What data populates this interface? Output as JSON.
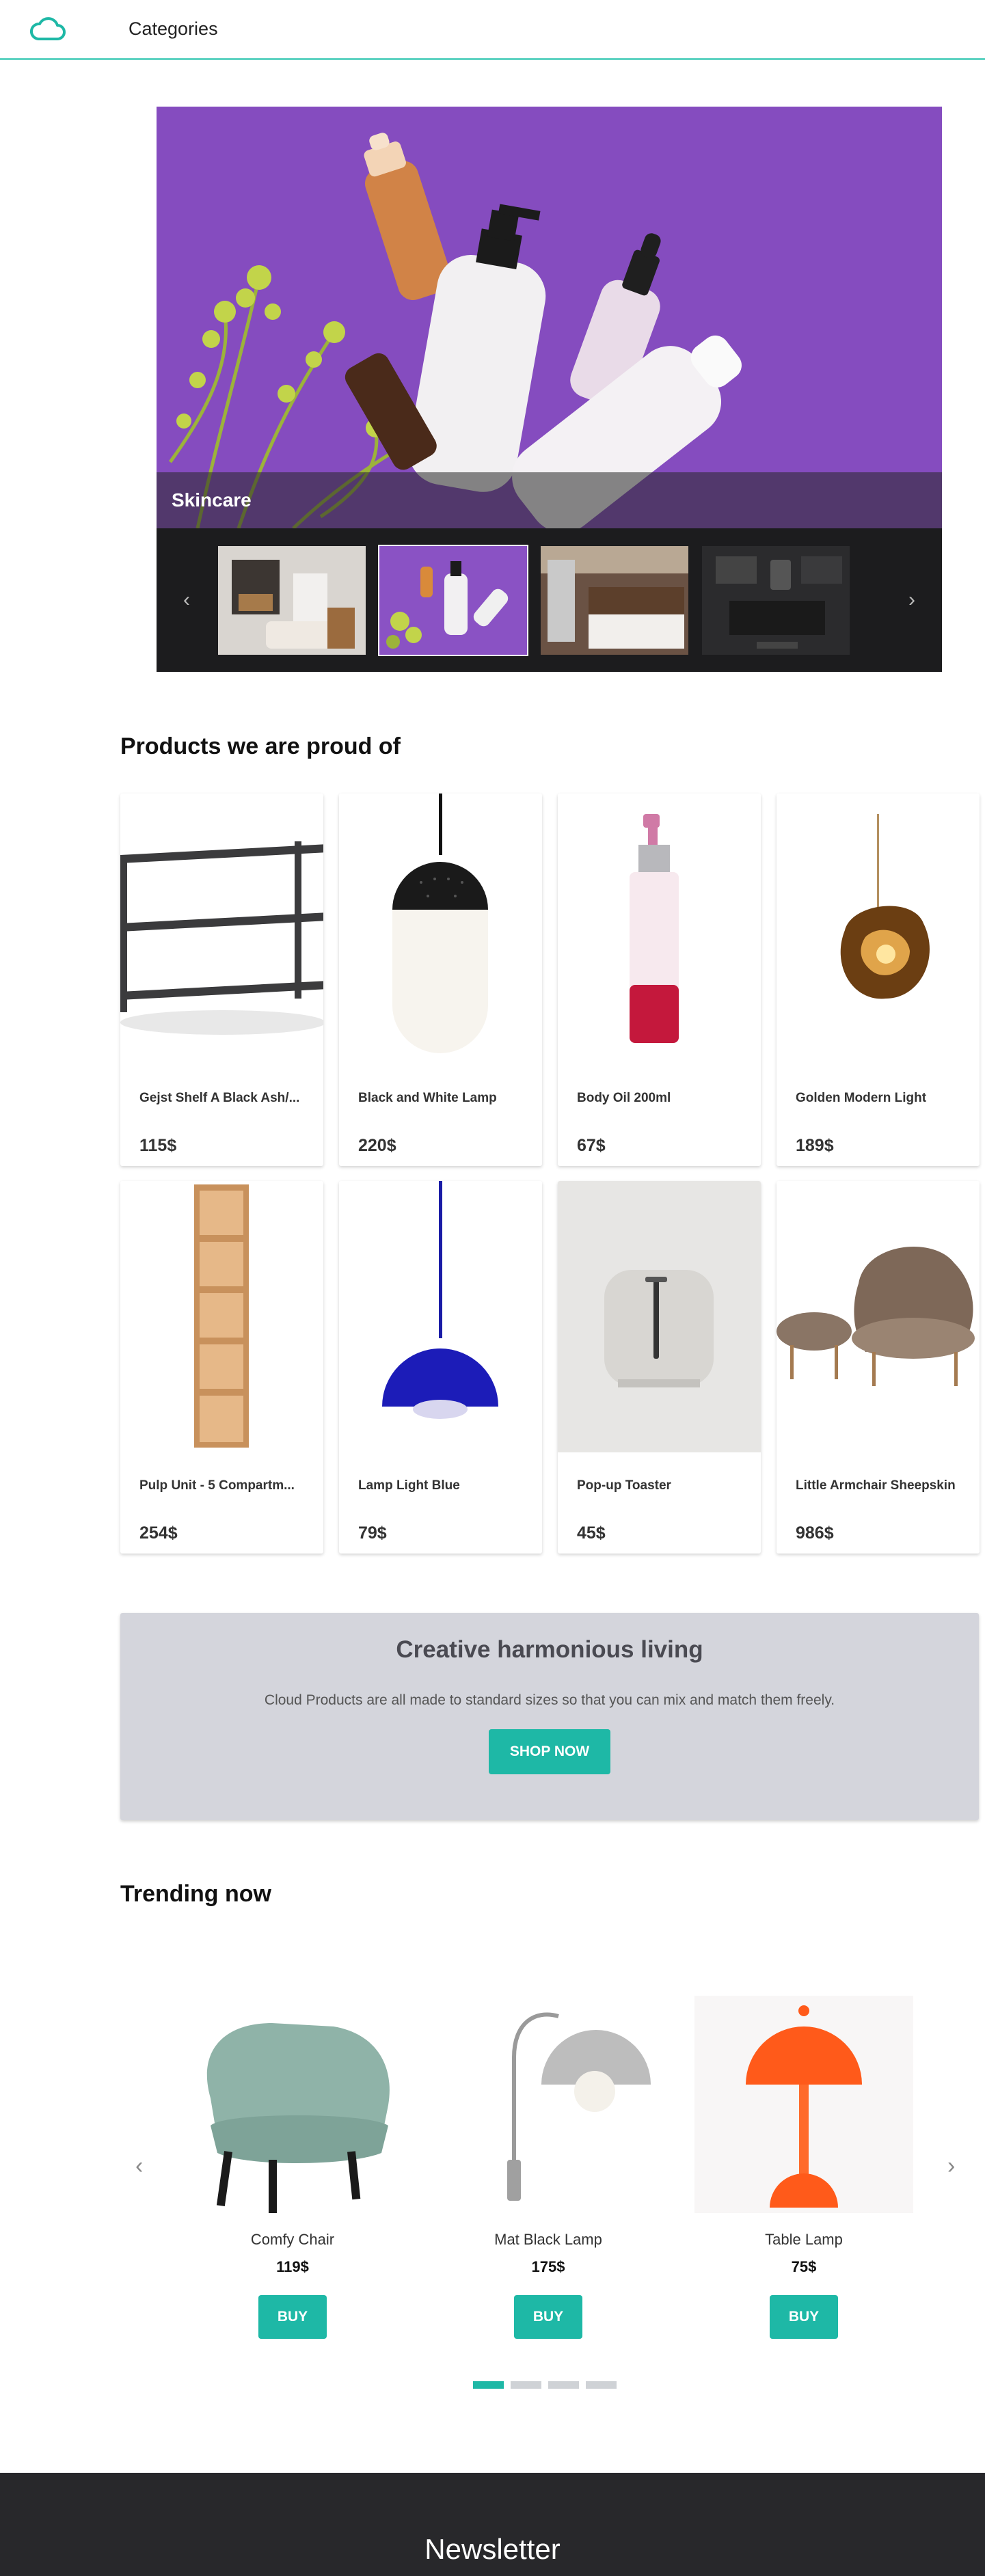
{
  "header": {
    "nav_label": "Categories"
  },
  "hero": {
    "caption": "Skincare",
    "thumbnails": [
      "living-room",
      "skincare",
      "kitchen",
      "desk-setup"
    ],
    "active_thumbnail": 1
  },
  "products_section": {
    "title": "Products we are proud of",
    "items": [
      {
        "name": "Gejst Shelf A Black Ash/...",
        "price": "115$"
      },
      {
        "name": "Black and White Lamp",
        "price": "220$"
      },
      {
        "name": "Body Oil 200ml",
        "price": "67$"
      },
      {
        "name": "Golden Modern Light",
        "price": "189$"
      },
      {
        "name": "Pulp Unit - 5 Compartm...",
        "price": "254$"
      },
      {
        "name": "Lamp Light Blue",
        "price": "79$"
      },
      {
        "name": "Pop-up Toaster",
        "price": "45$"
      },
      {
        "name": "Little Armchair Sheepskin",
        "price": "986$"
      }
    ]
  },
  "promo": {
    "title": "Creative harmonious living",
    "text": "Cloud Products are all made to standard sizes so that you can mix and match them freely.",
    "button": "SHOP NOW"
  },
  "trending": {
    "title": "Trending now",
    "items": [
      {
        "name": "Comfy Chair",
        "price": "119$",
        "button": "BUY"
      },
      {
        "name": "Mat Black Lamp",
        "price": "175$",
        "button": "BUY"
      },
      {
        "name": "Table Lamp",
        "price": "75$",
        "button": "BUY"
      }
    ],
    "active_dot": 0,
    "dot_count": 4
  },
  "newsletter": {
    "title": "Newsletter"
  },
  "colors": {
    "accent": "#1eb8a6",
    "header_line": "#5fd3c2",
    "promo_bg": "#d4d5dc",
    "footer_bg": "#28282b"
  }
}
